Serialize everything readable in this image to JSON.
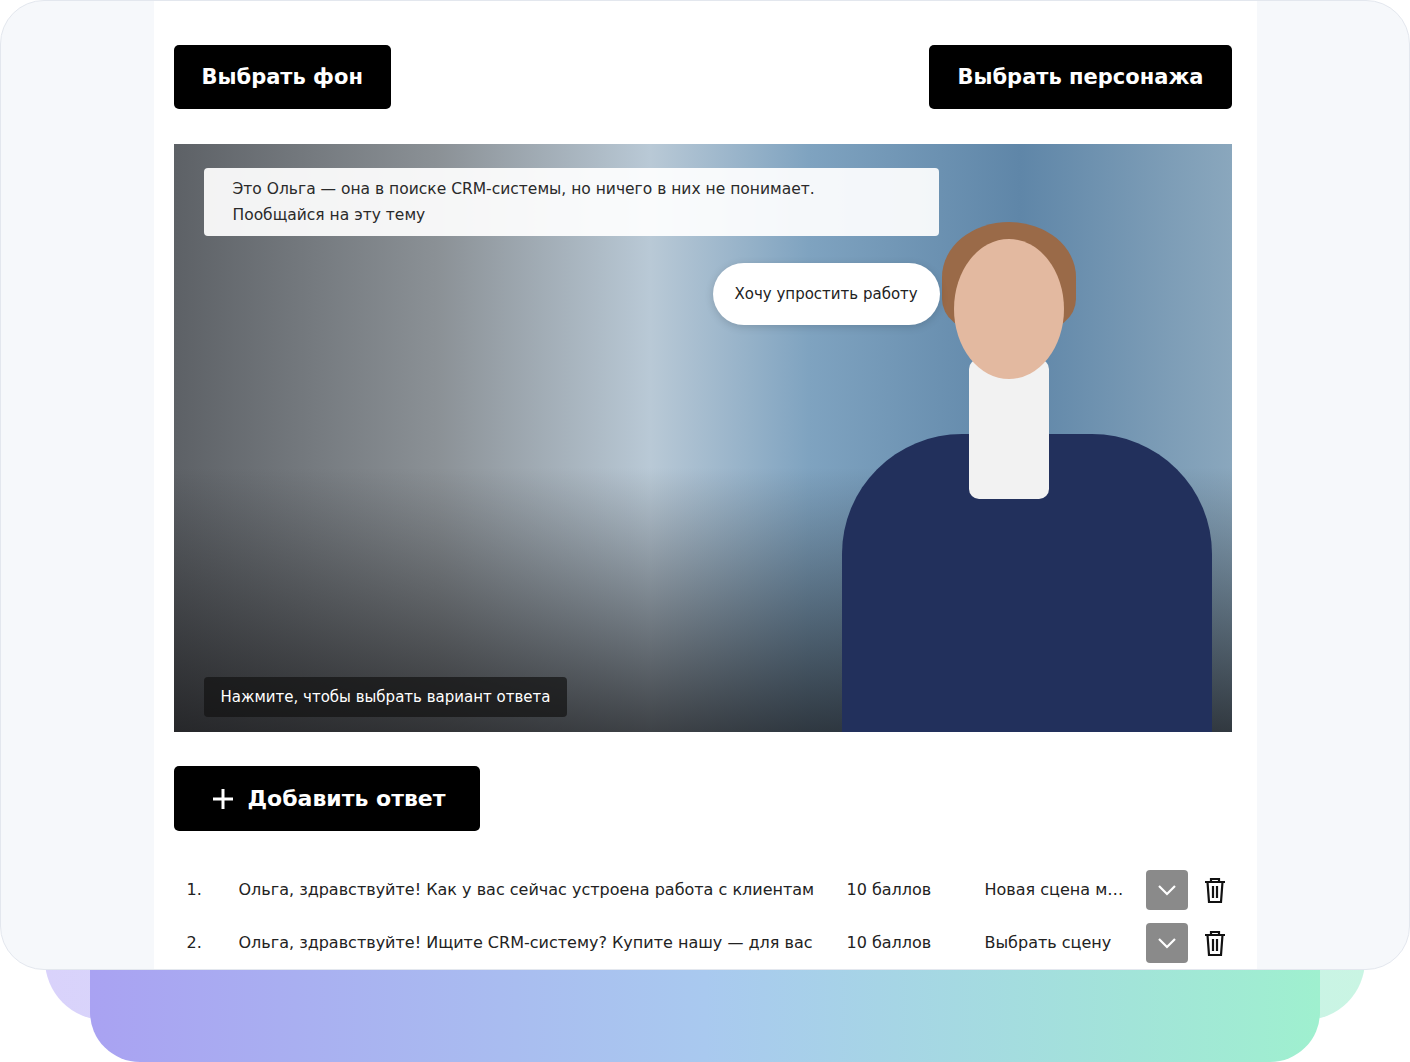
{
  "buttons": {
    "background": "Выбрать фон",
    "character": "Выбрать персонажа"
  },
  "scene": {
    "caption": [
      "Это Ольга — она в поиске CRM-системы, но ничего в них не понимает.",
      "Пообщайся на эту тему"
    ],
    "speech": "Хочу упростить работу",
    "hint": "Нажмите, чтобы выбрать вариант ответа"
  },
  "add_answer": {
    "label": "Добавить ответ"
  },
  "answers": [
    {
      "number": "1.",
      "text": "Ольга, здравствуйте! Как у вас сейчас устроена работа с клиентам",
      "points": "10 баллов",
      "scene": "Новая сцена м…"
    },
    {
      "number": "2.",
      "text": "Ольга, здравствуйте! Ищите CRM-систему? Купите нашу — для вас",
      "points": "10 баллов",
      "scene": "Выбрать сцену"
    }
  ]
}
